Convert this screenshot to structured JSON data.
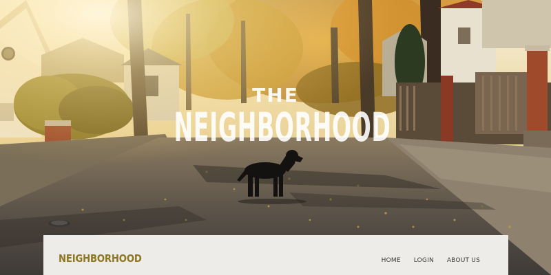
{
  "hero": {
    "title_small": "THE",
    "title_main": "NEIGHBORHOOD"
  },
  "nav": {
    "brand": "NEIGHBORHOOD",
    "links": [
      {
        "label": "HOME"
      },
      {
        "label": "LOGIN"
      },
      {
        "label": "ABOUT US"
      }
    ]
  },
  "colors": {
    "brand": "#8e7722",
    "nav_bg": "#f4f2ee",
    "hero_text": "#ffffff"
  }
}
